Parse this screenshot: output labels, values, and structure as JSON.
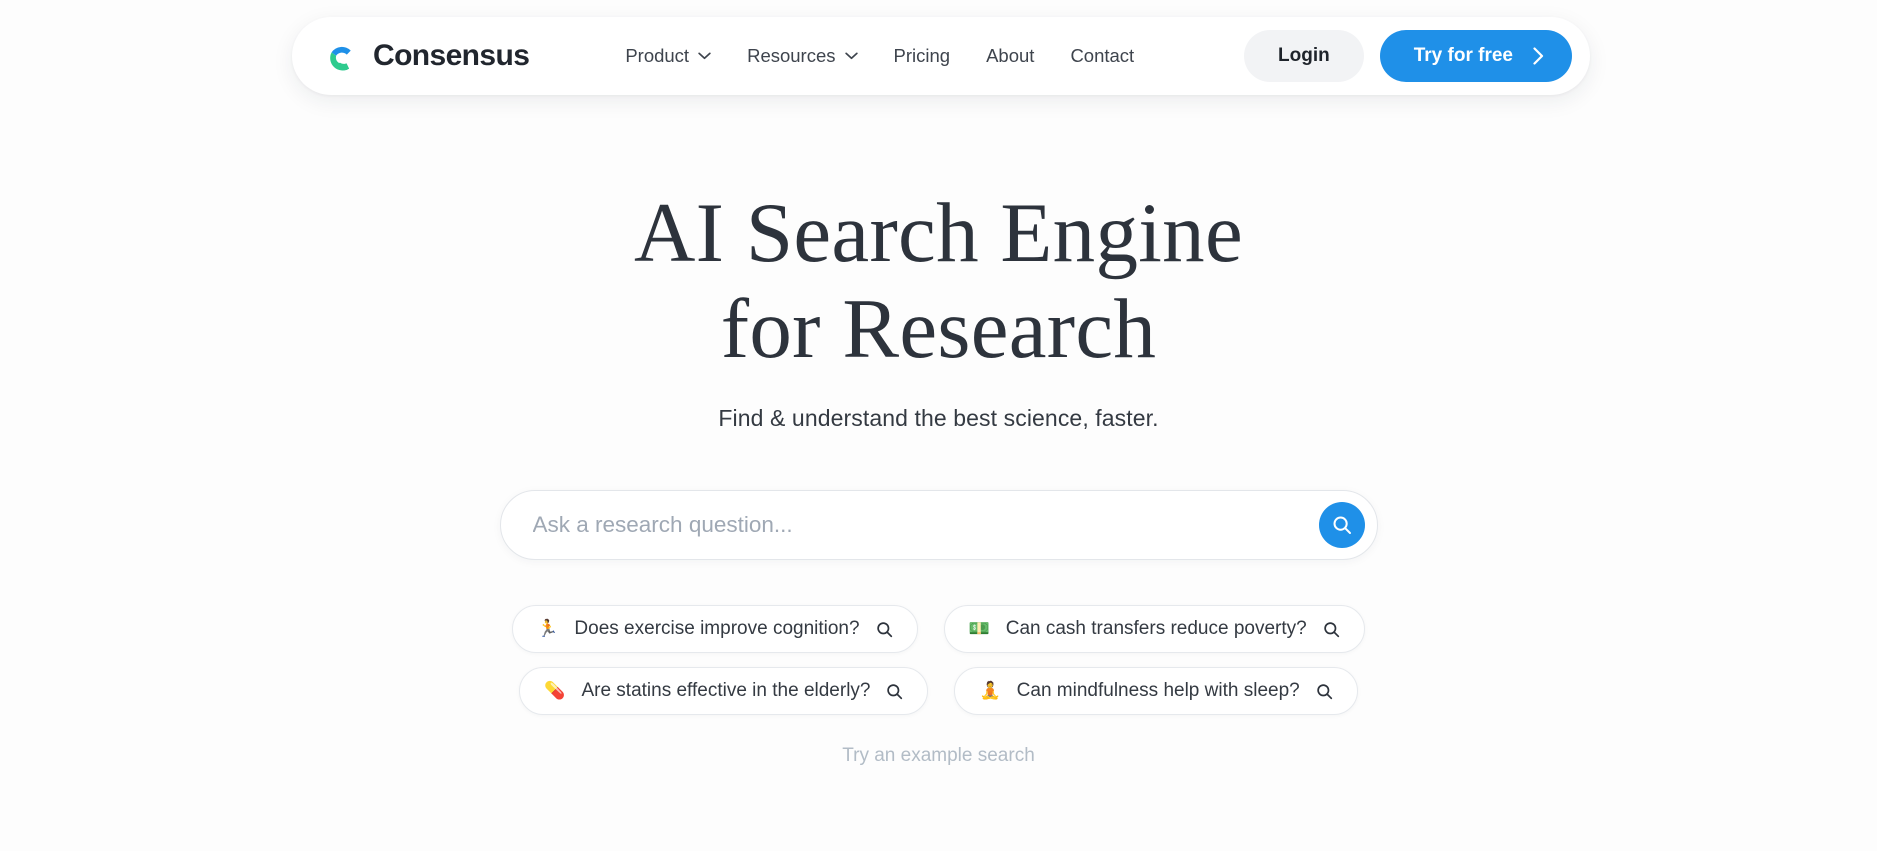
{
  "brand": {
    "name": "Consensus",
    "logo_icon": "consensus-c-logo",
    "logo_blue": "#1f90e8",
    "logo_green": "#2ecb8e"
  },
  "header": {
    "nav": [
      {
        "label": "Product",
        "has_dropdown": true,
        "icon": "chevron-down-icon"
      },
      {
        "label": "Resources",
        "has_dropdown": true,
        "icon": "chevron-down-icon"
      },
      {
        "label": "Pricing",
        "has_dropdown": false,
        "icon": ""
      },
      {
        "label": "About",
        "has_dropdown": false,
        "icon": ""
      },
      {
        "label": "Contact",
        "has_dropdown": false,
        "icon": ""
      }
    ],
    "login_label": "Login",
    "cta_label": "Try for free",
    "cta_icon": "chevron-right-icon",
    "cta_color": "#1f90e8"
  },
  "hero": {
    "headline_line1": "AI Search Engine",
    "headline_line2": "for Research",
    "subhead": "Find & understand the best science, faster."
  },
  "search": {
    "value": "",
    "placeholder": "Ask a research question...",
    "button_icon": "search-icon",
    "button_color": "#1f90e8"
  },
  "suggestions": {
    "chips": [
      {
        "emoji": "🏃",
        "emoji_name": "runner-emoji",
        "label": "Does exercise improve cognition?",
        "icon": "search-icon"
      },
      {
        "emoji": "💵",
        "emoji_name": "banknote-emoji",
        "label": "Can cash transfers reduce poverty?",
        "icon": "search-icon"
      },
      {
        "emoji": "💊",
        "emoji_name": "pill-emoji",
        "label": "Are statins effective in the elderly?",
        "icon": "search-icon"
      },
      {
        "emoji": "🧘",
        "emoji_name": "meditation-emoji",
        "label": "Can mindfulness help with sleep?",
        "icon": "search-icon"
      }
    ],
    "note": "Try an example search"
  }
}
